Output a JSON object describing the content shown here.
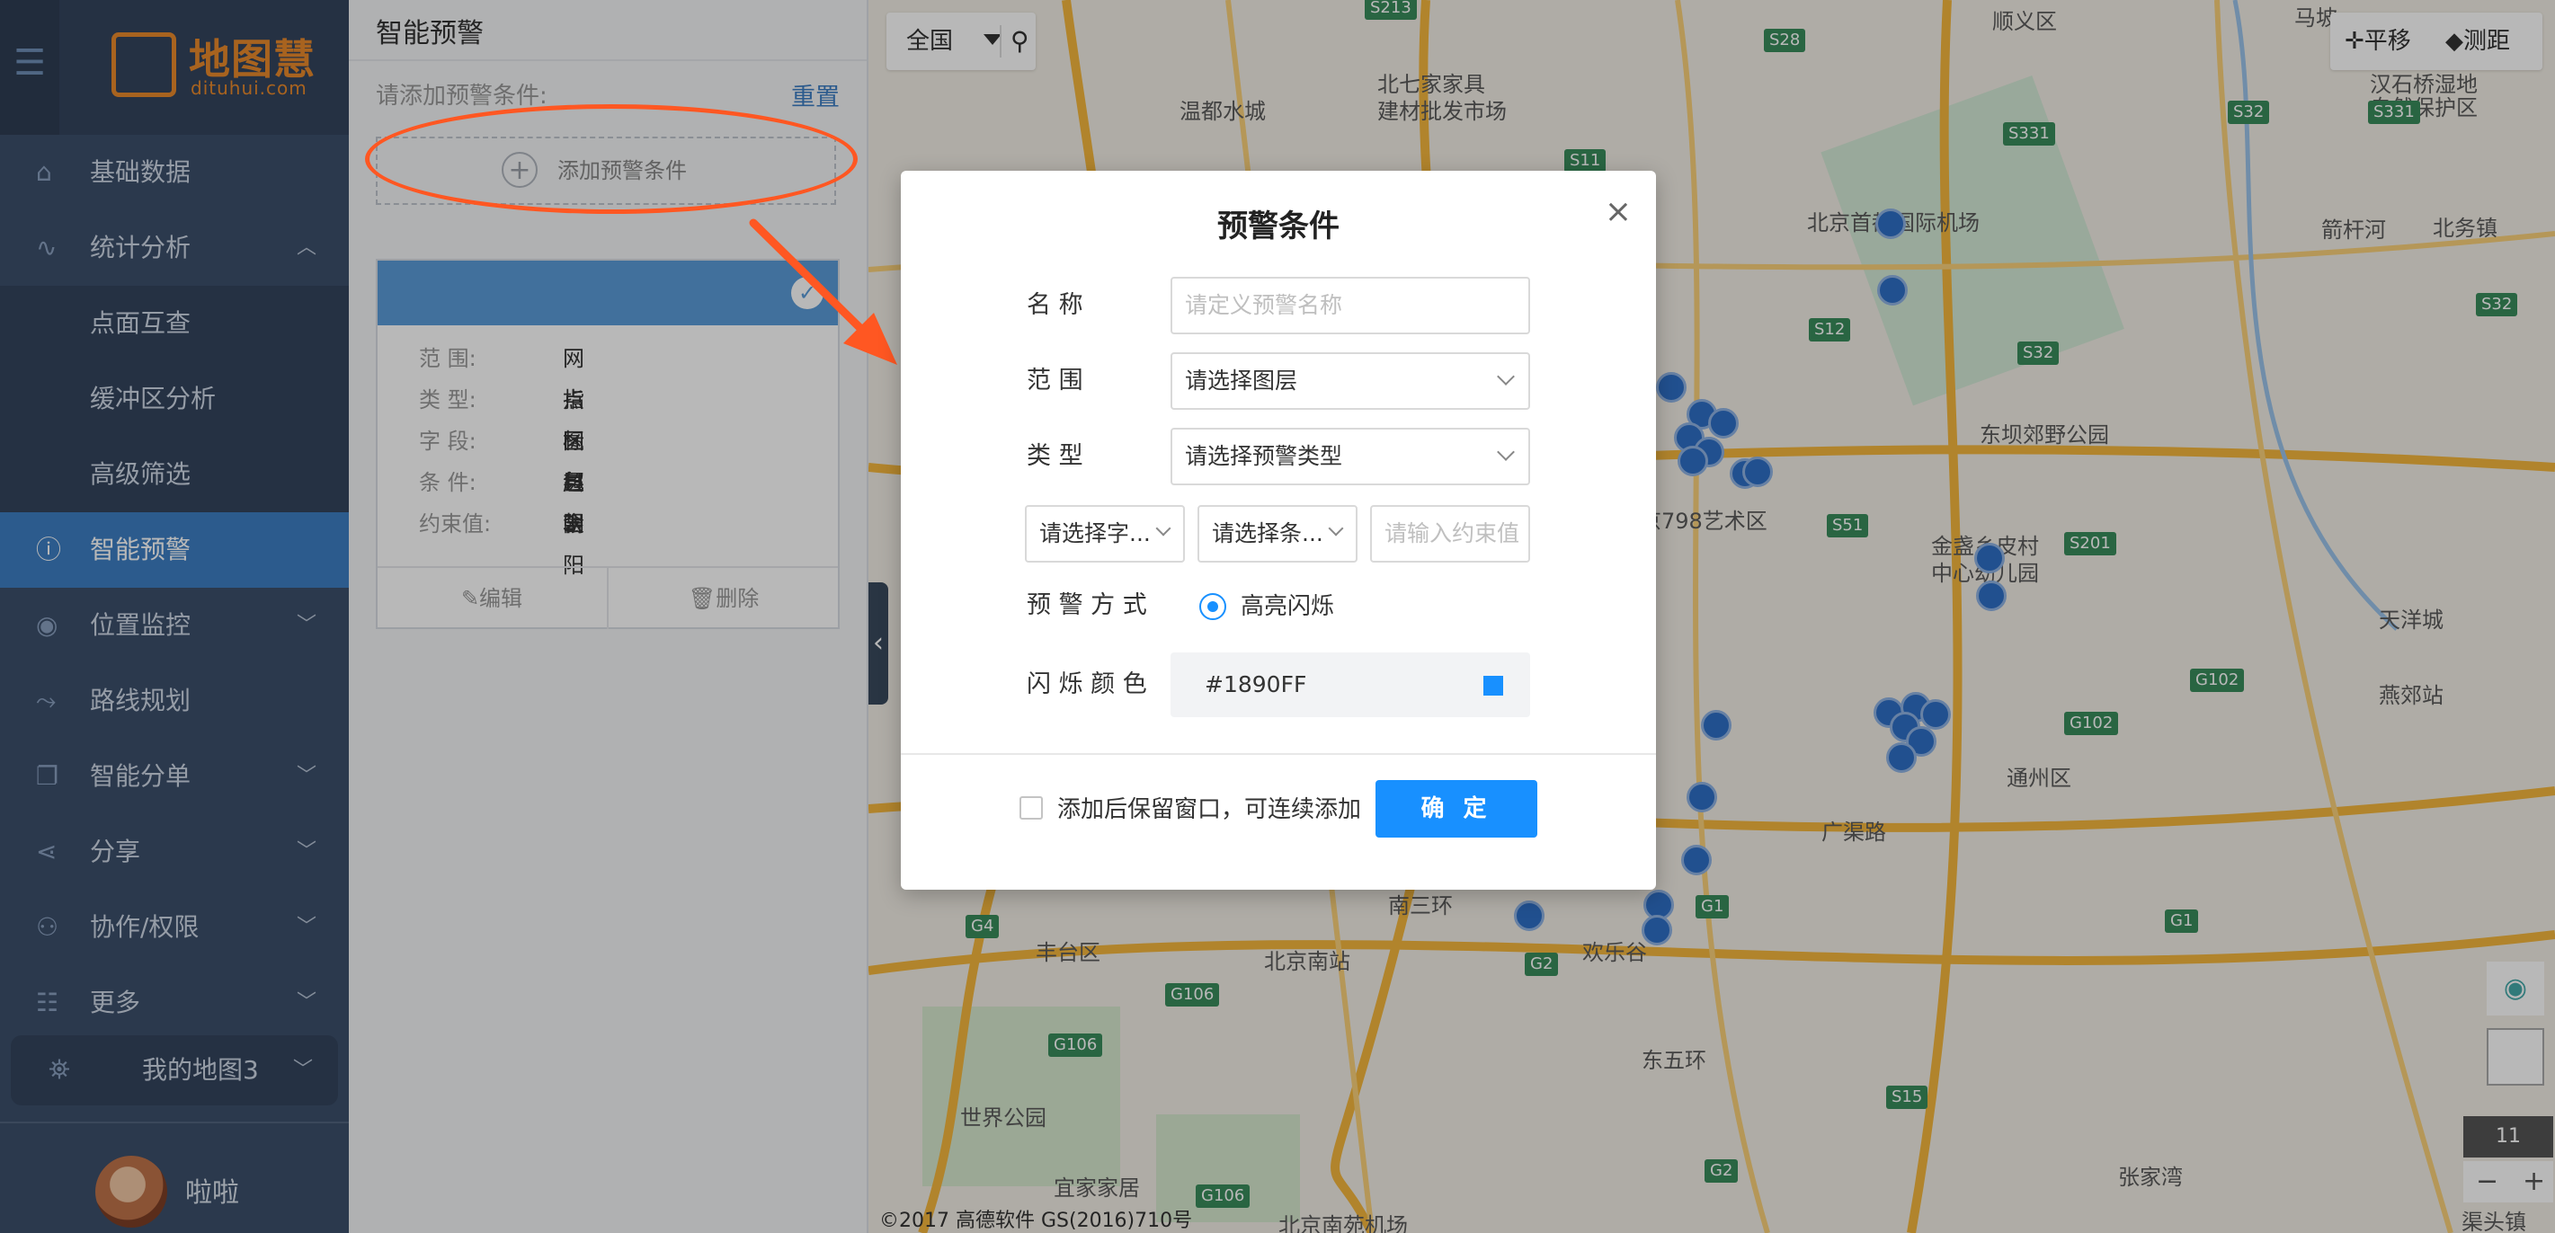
{
  "logo": {
    "name": "地图慧",
    "domain": "dituhui.com",
    "color": "#e9892c"
  },
  "sidebar": {
    "items": [
      {
        "label": "基础数据",
        "icon": "home-icon"
      },
      {
        "label": "统计分析",
        "icon": "chart-icon",
        "expanded": true
      },
      {
        "label": "点面互查",
        "sub": true
      },
      {
        "label": "缓冲区分析",
        "sub": true
      },
      {
        "label": "高级筛选",
        "sub": true
      },
      {
        "label": "智能预警",
        "icon": "alert-icon",
        "active": true
      },
      {
        "label": "位置监控",
        "icon": "location-icon"
      },
      {
        "label": "路线规划",
        "icon": "route-icon"
      },
      {
        "label": "智能分单",
        "icon": "copy-icon"
      },
      {
        "label": "分享",
        "icon": "share-icon"
      },
      {
        "label": "协作/权限",
        "icon": "user-icon"
      },
      {
        "label": "更多",
        "icon": "list-icon"
      }
    ],
    "my_map": "我的地图3",
    "user_name": "啦啦"
  },
  "panel": {
    "title": "智能预警",
    "prompt": "请添加预警条件:",
    "reset": "重置",
    "add_condition": "添加预警条件",
    "card": {
      "rows": [
        {
          "key": "范    围:",
          "value": "网点图层3"
        },
        {
          "key": "类    型:",
          "value": "指标超限"
        },
        {
          "key": "字    段:",
          "value": "区县"
        },
        {
          "key": "条    件:",
          "value": "包含"
        },
        {
          "key": "约束值:",
          "value": "朝阳"
        }
      ],
      "edit": "✎编辑",
      "delete": "🗑删除"
    }
  },
  "map": {
    "search_region": "全国",
    "tool_pan": "✛平移",
    "tool_measure": "◆测距",
    "copyright": "©2017 高德软件 GS(2016)710号",
    "zoom_level": "11",
    "zoom_out": "−",
    "zoom_in": "+",
    "labels": [
      {
        "text": "顺义区"
      },
      {
        "text": "北七家家具"
      },
      {
        "text": "建材批发市场"
      },
      {
        "text": "温都水城"
      },
      {
        "text": "北京首都国际机场"
      },
      {
        "text": "汉石桥湿地"
      },
      {
        "text": "自然保护区"
      },
      {
        "text": "北务镇"
      },
      {
        "text": "东坝郊野公园"
      },
      {
        "text": "北京798艺术区"
      },
      {
        "text": "金盏乡皮村"
      },
      {
        "text": "中心幼儿园"
      },
      {
        "text": "天洋城"
      },
      {
        "text": "燕郊站"
      },
      {
        "text": "通州区"
      },
      {
        "text": "丰台区"
      },
      {
        "text": "北京南站"
      },
      {
        "text": "南三环"
      },
      {
        "text": "欢乐谷"
      },
      {
        "text": "世界公园"
      },
      {
        "text": "宜家家居"
      },
      {
        "text": "张家湾"
      },
      {
        "text": "渠头镇"
      },
      {
        "text": "广渠路"
      },
      {
        "text": "东五环"
      },
      {
        "text": "北京南苑机场"
      },
      {
        "text": "箭杆河"
      },
      {
        "text": "马坡"
      }
    ],
    "shields": [
      "S213",
      "S28",
      "S331",
      "S331",
      "S11",
      "S12",
      "S32",
      "S32",
      "S51",
      "S201",
      "G102",
      "G102",
      "G1",
      "G1",
      "G4",
      "G106",
      "G2",
      "G2",
      "G106",
      "G106",
      "S15",
      "S32"
    ]
  },
  "dialog": {
    "title": "预警条件",
    "close": "×",
    "name_label": "名        称",
    "name_placeholder": "请定义预警名称",
    "range_label": "范        围",
    "range_value": "请选择图层",
    "type_label": "类        型",
    "type_value": "请选择预警类型",
    "field_select": "请选择字...",
    "cond_select": "请选择条...",
    "constraint_placeholder": "请输入约束值",
    "method_label": "预 警 方 式",
    "method_option": "高亮闪烁",
    "color_label": "闪 烁 颜 色",
    "color_value": "#1890FF",
    "keep_open": "添加后保留窗口，可连续添加",
    "ok": "确 定"
  },
  "colors": {
    "sidebar_bg": "#3c4f6b",
    "active": "#3e7fc4",
    "primary": "#1890ff",
    "annotation": "#ff5722",
    "marker": "#2f6fc7"
  }
}
